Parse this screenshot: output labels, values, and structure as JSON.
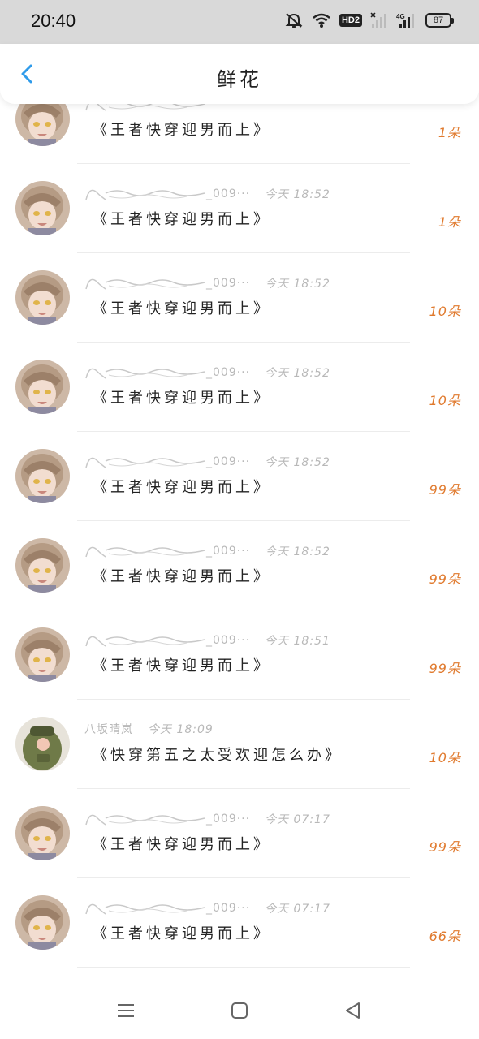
{
  "status_bar": {
    "time": "20:40",
    "hd_badge": "HD2",
    "network": "4G",
    "battery": "87",
    "icons": [
      "mute-icon",
      "wifi-icon",
      "hd-icon",
      "signal-off-icon",
      "signal-icon",
      "battery-icon"
    ]
  },
  "header": {
    "title": "鲜花",
    "back_icon": "chevron-left-icon"
  },
  "list": {
    "items": [
      {
        "name": "",
        "time": "",
        "book": "《王者快穿迎男而上》",
        "count": "1朵",
        "avatar": "anime-girl"
      },
      {
        "name": "_009···",
        "time": "今天 18:52",
        "book": "《王者快穿迎男而上》",
        "count": "1朵",
        "avatar": "anime-girl"
      },
      {
        "name": "_009···",
        "time": "今天 18:52",
        "book": "《王者快穿迎男而上》",
        "count": "10朵",
        "avatar": "anime-girl"
      },
      {
        "name": "_009···",
        "time": "今天 18:52",
        "book": "《王者快穿迎男而上》",
        "count": "10朵",
        "avatar": "anime-girl"
      },
      {
        "name": "_009···",
        "time": "今天 18:52",
        "book": "《王者快穿迎男而上》",
        "count": "99朵",
        "avatar": "anime-girl"
      },
      {
        "name": "_009···",
        "time": "今天 18:52",
        "book": "《王者快穿迎男而上》",
        "count": "99朵",
        "avatar": "anime-girl"
      },
      {
        "name": "_009···",
        "time": "今天 18:51",
        "book": "《王者快穿迎男而上》",
        "count": "99朵",
        "avatar": "anime-girl"
      },
      {
        "name": "八坂晴岚",
        "time": "今天 18:09",
        "book": "《快穿第五之太受欢迎怎么办》",
        "count": "10朵",
        "avatar": "green-bag"
      },
      {
        "name": "_009···",
        "time": "今天 07:17",
        "book": "《王者快穿迎男而上》",
        "count": "99朵",
        "avatar": "anime-girl"
      },
      {
        "name": "_009···",
        "time": "今天 07:17",
        "book": "《王者快穿迎男而上》",
        "count": "66朵",
        "avatar": "anime-girl"
      }
    ]
  },
  "nav_bar": {
    "icons": [
      "menu-icon",
      "home-square-icon",
      "back-triangle-icon"
    ]
  },
  "colors": {
    "accent": "#2f9bea",
    "count": "#e07a2e",
    "status_bar_bg": "#d9d9d9",
    "meta_text": "#b8b8b8"
  }
}
